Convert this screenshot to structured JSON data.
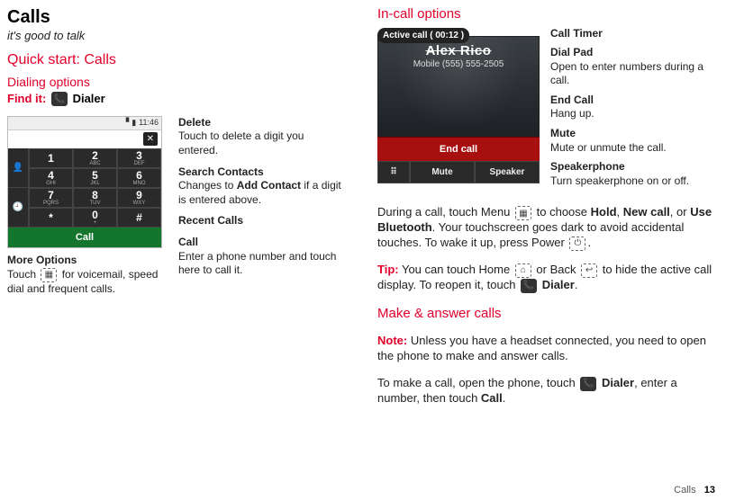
{
  "header": {
    "title": "Calls",
    "subtitle": "it's good to talk"
  },
  "quick_start": {
    "heading": "Quick start: Calls",
    "dialing_heading": "Dialing options",
    "find_it_label": "Find it:",
    "find_it_value": "Dialer",
    "phone_icon": "📞"
  },
  "dial_mock": {
    "time": "11:46",
    "delete_glyph": "✕",
    "side_icons": [
      "👤",
      "🕘"
    ],
    "keys": [
      {
        "n": "1",
        "l": ""
      },
      {
        "n": "2",
        "l": "ABC"
      },
      {
        "n": "3",
        "l": "DEF"
      },
      {
        "n": "4",
        "l": "GHI"
      },
      {
        "n": "5",
        "l": "JKL"
      },
      {
        "n": "6",
        "l": "MNO"
      },
      {
        "n": "7",
        "l": "PQRS"
      },
      {
        "n": "8",
        "l": "TUV"
      },
      {
        "n": "9",
        "l": "WXY"
      },
      {
        "n": "*",
        "l": ""
      },
      {
        "n": "0",
        "l": "+"
      },
      {
        "n": "#",
        "l": ""
      }
    ],
    "call_label": "Call"
  },
  "dial_callouts": {
    "delete_t": "Delete",
    "delete_d": "Touch to delete a digit you entered.",
    "search_t": "Search Contacts",
    "search_d1": "Changes to ",
    "search_d_bold": "Add Contact",
    "search_d2": " if a digit is entered above.",
    "recent_t": "Recent Calls",
    "call_t": "Call",
    "call_d": "Enter a phone number and touch here to call it.",
    "more_t": "More Options",
    "more_d1": "Touch ",
    "more_icon": "▦",
    "more_d2": " for voicemail, speed dial and frequent calls."
  },
  "incall": {
    "heading": "In-call options",
    "active_label": "Active call ( 00:12 )",
    "caller_name": "Alex Rico",
    "caller_line": "Mobile (555) 555-2505",
    "end_label": "End call",
    "pad_icon": "⠿",
    "mute_label": "Mute",
    "speaker_label": "Speaker"
  },
  "incall_callouts": [
    {
      "t": "Call Timer",
      "d": ""
    },
    {
      "t": "Dial Pad",
      "d": "Open to enter numbers during a call."
    },
    {
      "t": "End Call",
      "d": "Hang up."
    },
    {
      "t": "Mute",
      "d": "Mute or unmute the call."
    },
    {
      "t": "Speakerphone",
      "d": "Turn speakerphone on or off."
    }
  ],
  "body": {
    "during1a": "During a call, touch Menu ",
    "menu_icon": "▦",
    "during1b": " to choose ",
    "hold": "Hold",
    "comma1": ", ",
    "newcall": "New call",
    "comma2": ", or ",
    "usebt": "Use Bluetooth",
    "during2": ". Your touchscreen goes dark to avoid accidental touches. To wake it up, press Power ",
    "power_icon": "⏻",
    "period": ".",
    "tip_label": "Tip:",
    "tip_a": " You can touch Home ",
    "home_icon": "⌂",
    "tip_b": " or Back ",
    "back_icon": "↩",
    "tip_c": " to hide the active call display. To reopen it, touch ",
    "tip_dialer": "Dialer",
    "make_heading": "Make & answer calls",
    "note_label": "Note:",
    "note_body": " Unless you have a headset connected, you need to open the phone to make and answer calls.",
    "make_a": "To make a call, open the phone, touch ",
    "make_dialer": "Dialer",
    "make_b": ", enter a number, then touch ",
    "make_call": "Call"
  },
  "footer": {
    "section": "Calls",
    "page": "13"
  }
}
